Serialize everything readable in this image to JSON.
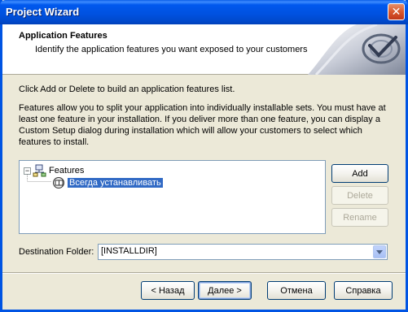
{
  "window": {
    "title": "Project Wizard",
    "close_glyph": "✕"
  },
  "header": {
    "title": "Application Features",
    "subtitle": "Identify the application features you want exposed to your customers"
  },
  "instructions": {
    "line1": "Click Add or Delete to build an application features list.",
    "line2": "Features allow you to split your application into individually installable sets. You must have at least one feature in your installation. If you deliver more than one feature, you can display a Custom Setup dialog during installation which will allow your customers to select which features to install."
  },
  "tree": {
    "root_label": "Features",
    "expander_glyph": "−",
    "items": [
      {
        "label": "Всегда устанавливать",
        "selected": true
      }
    ]
  },
  "side_buttons": {
    "add": "Add",
    "delete": "Delete",
    "rename": "Rename"
  },
  "destination": {
    "label": "Destination Folder:",
    "value": "[INSTALLDIR]"
  },
  "footer": {
    "back": "< Назад",
    "next": "Далее >",
    "cancel": "Отмена",
    "help": "Справка"
  },
  "colors": {
    "selection": "#316ac5",
    "titlebar": "#0054e3"
  },
  "icons": {
    "root": "features-tree-icon",
    "item": "feature-icon",
    "header": "wizard-logo-icon",
    "dropdown": "dropdown-arrow-icon"
  }
}
